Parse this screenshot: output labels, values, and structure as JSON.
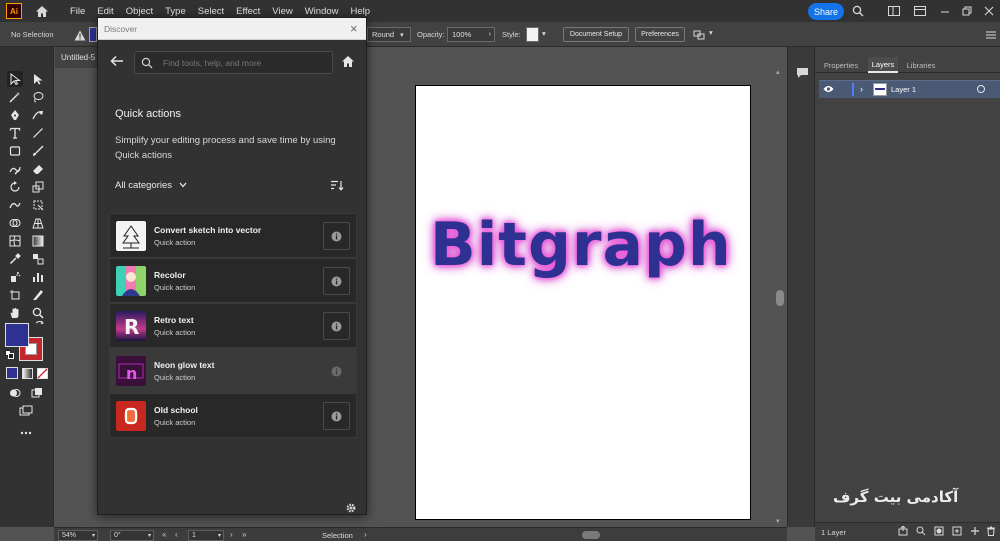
{
  "app": {
    "logo_text": "Ai",
    "menu": [
      "File",
      "Edit",
      "Object",
      "Type",
      "Select",
      "Effect",
      "View",
      "Window",
      "Help"
    ],
    "share_label": "Share"
  },
  "control_bar": {
    "selection_label": "No Selection",
    "stroke_style_value": "Round",
    "opacity_label": "Opacity:",
    "opacity_value": "100%",
    "style_label": "Style:",
    "document_setup_label": "Document Setup",
    "preferences_label": "Preferences"
  },
  "document": {
    "tab_title": "Untitled-5",
    "artboard_text": "Bitgraph",
    "colors": {
      "text_fill": "#2e3192",
      "glow": "#e24fd6",
      "tool_fill": "#2e3192",
      "tool_stroke": "#c1272d"
    }
  },
  "discover": {
    "title": "Discover",
    "search_placeholder": "Find tools, help, and more",
    "heading": "Quick actions",
    "description": "Simplify your editing process and save time by using Quick actions",
    "category_label": "All categories",
    "actions": [
      {
        "title": "Convert sketch into vector",
        "subtitle": "Quick action",
        "icon": "tree-sketch-icon"
      },
      {
        "title": "Recolor",
        "subtitle": "Quick action",
        "icon": "recolor-icon"
      },
      {
        "title": "Retro text",
        "subtitle": "Quick action",
        "icon": "retro-text-icon"
      },
      {
        "title": "Neon glow text",
        "subtitle": "Quick action",
        "icon": "neon-glow-icon"
      },
      {
        "title": "Old school",
        "subtitle": "Quick action",
        "icon": "old-school-icon"
      }
    ]
  },
  "layers_panel": {
    "tabs": [
      "Properties",
      "Layers",
      "Libraries"
    ],
    "active_tab": "Layers",
    "layers": [
      {
        "name": "Layer 1"
      }
    ],
    "footer_count": "1 Layer"
  },
  "status_bar": {
    "zoom": "54%",
    "rotation": "0°",
    "artboard_number": "1",
    "tool_status": "Selection"
  },
  "watermark": {
    "text": "آکادمی بیت گرف"
  }
}
